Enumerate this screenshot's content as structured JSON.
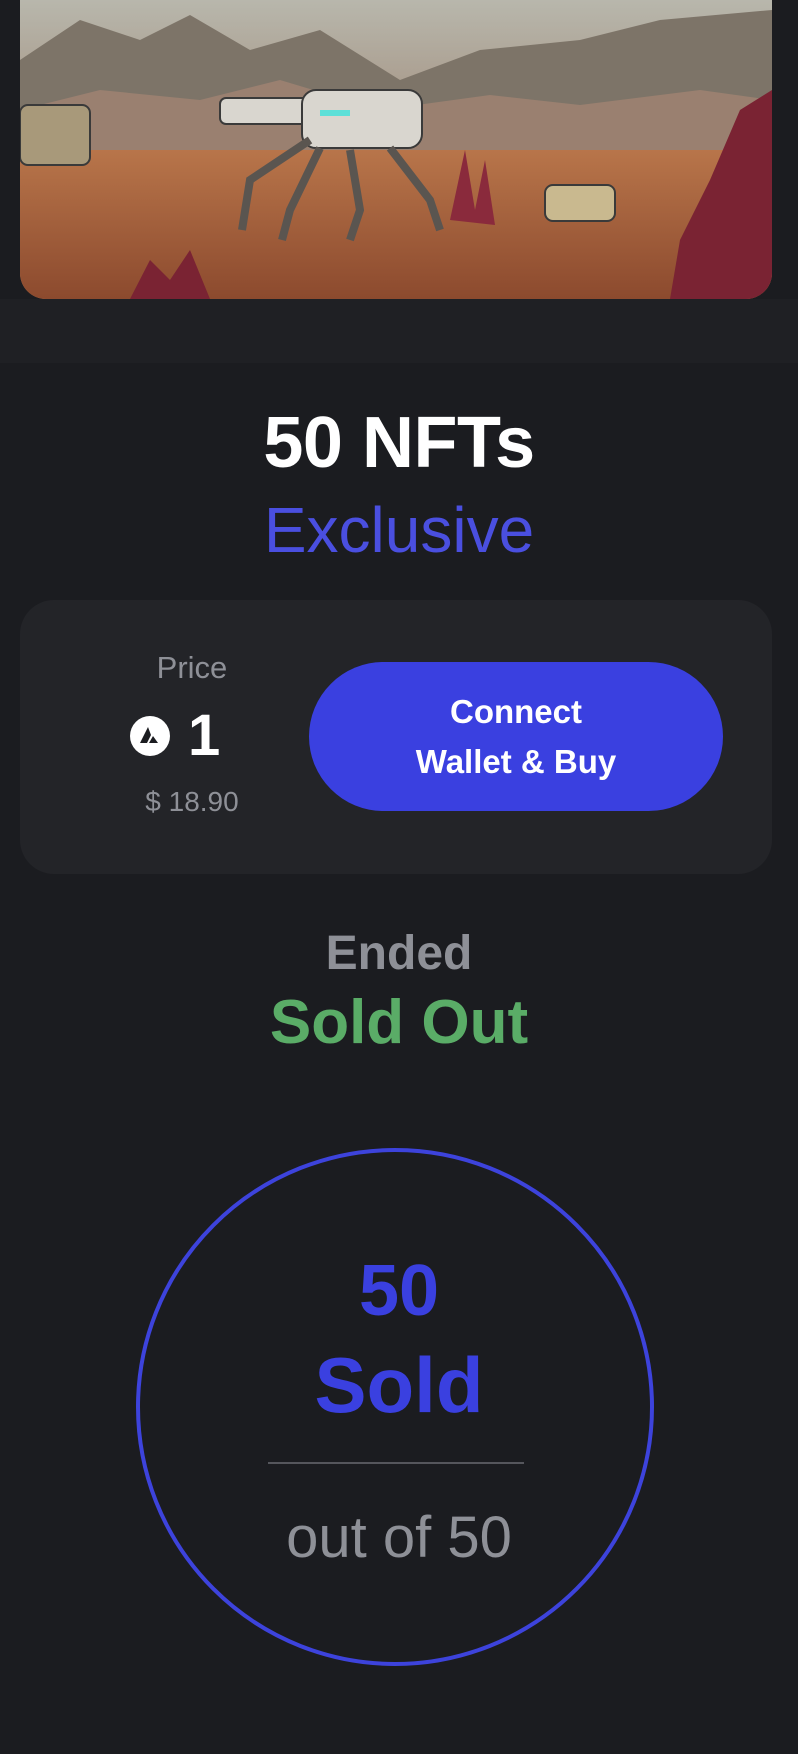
{
  "collection": {
    "title": "50 NFTs",
    "tier": "Exclusive"
  },
  "price": {
    "label": "Price",
    "currency_icon": "avax-icon",
    "amount": "1",
    "usd": "$ 18.90"
  },
  "buy_button": {
    "line1": "Connect",
    "line2": "Wallet & Buy"
  },
  "status": {
    "label": "Ended",
    "value": "Sold Out"
  },
  "supply": {
    "sold_count": "50",
    "sold_word": "Sold",
    "total_text": "out of 50"
  },
  "colors": {
    "background": "#1b1c20",
    "card": "#232428",
    "accent": "#3a40e0",
    "success": "#5aac67",
    "muted": "#8e9097"
  }
}
